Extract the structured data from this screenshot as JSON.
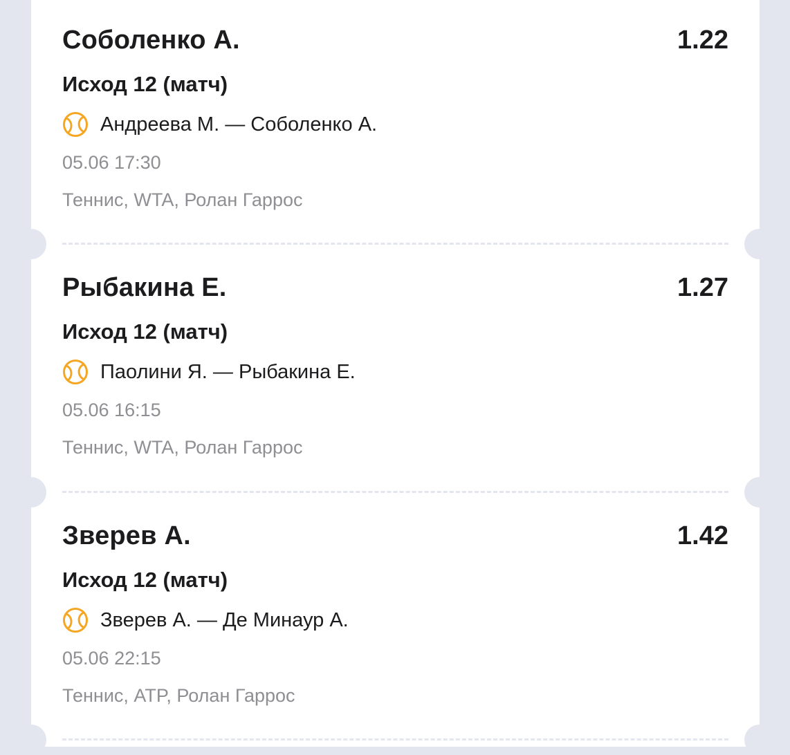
{
  "accent_color": "#f5a623",
  "bets": [
    {
      "pick": "Соболенко А.",
      "odds": "1.22",
      "market": "Исход 12 (матч)",
      "event": "Андреева М. — Соболенко А.",
      "date": "05.06 17:30",
      "league": "Теннис,  WTA, Ролан Гаррос",
      "sport_icon": "tennis-ball-icon"
    },
    {
      "pick": "Рыбакина Е.",
      "odds": "1.27",
      "market": "Исход 12 (матч)",
      "event": "Паолини Я. — Рыбакина Е.",
      "date": "05.06 16:15",
      "league": "Теннис,  WTA, Ролан Гаррос",
      "sport_icon": "tennis-ball-icon"
    },
    {
      "pick": "Зверев А.",
      "odds": "1.42",
      "market": "Исход 12 (матч)",
      "event": "Зверев А. — Де Минаур А.",
      "date": "05.06 22:15",
      "league": "Теннис,  ATP, Ролан Гаррос",
      "sport_icon": "tennis-ball-icon"
    }
  ]
}
